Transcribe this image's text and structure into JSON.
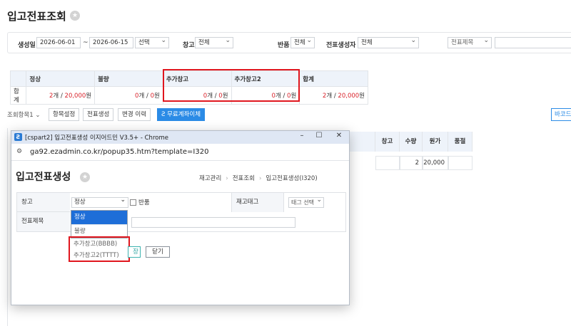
{
  "main": {
    "title": "입고전표조회",
    "star_icon": "star-icon",
    "filters": {
      "date_label": "생성일",
      "date_from": "2026-06-01",
      "date_sep": "~",
      "date_to": "2026-06-15",
      "date_preset": "선택",
      "warehouse_label": "창고",
      "warehouse_value": "전체",
      "return_label": "반품",
      "return_value": "전체",
      "creator_label": "전표생성자",
      "creator_value": "전체",
      "title_filter": "전표제목"
    },
    "summary": {
      "headers": [
        "",
        "정상",
        "불량",
        "추가창고",
        "추가창고2",
        "합계"
      ],
      "row_label": "합계",
      "cells": [
        {
          "count": "2",
          "amount": "20,000"
        },
        {
          "count": "0",
          "amount": "0"
        },
        {
          "count": "0",
          "amount": "0"
        },
        {
          "count": "0",
          "amount": "0"
        },
        {
          "count": "2",
          "amount": "20,000"
        }
      ],
      "unit_count": "개",
      "unit_amount": "원",
      "sep": "/"
    },
    "toolbar": {
      "view_items": "조회항목1",
      "item_settings": "항목설정",
      "create_slip": "전표생성",
      "change_history": "변경 이력",
      "free_trial": "무료계좌이체",
      "barcode": "바코드"
    },
    "grid": {
      "headers": [
        "창고",
        "수량",
        "원가",
        "품절"
      ],
      "row": {
        "qty": "2",
        "cost": "20,000"
      }
    }
  },
  "popup": {
    "window_title": "[cspart2] 입고전표생성 이지어드민 V3.5+ - Chrome",
    "url": "ga92.ezadmin.co.kr/popup35.htm?template=I320",
    "title": "입고전표생성",
    "breadcrumb": [
      "재고관리",
      "전표조회",
      "입고전표생성(I320)"
    ],
    "form": {
      "warehouse_label": "창고",
      "warehouse_value": "정상",
      "return_label": "반품",
      "tag_label": "재고태그",
      "tag_value": "태그 선택",
      "title_label": "전표제목"
    },
    "dropdown": {
      "options": [
        "정상",
        "불량"
      ],
      "extra_options": [
        "추가창고(BBBB)",
        "추가창고2(TTTT)"
      ]
    },
    "save_label": "장",
    "close_label": "닫기"
  }
}
